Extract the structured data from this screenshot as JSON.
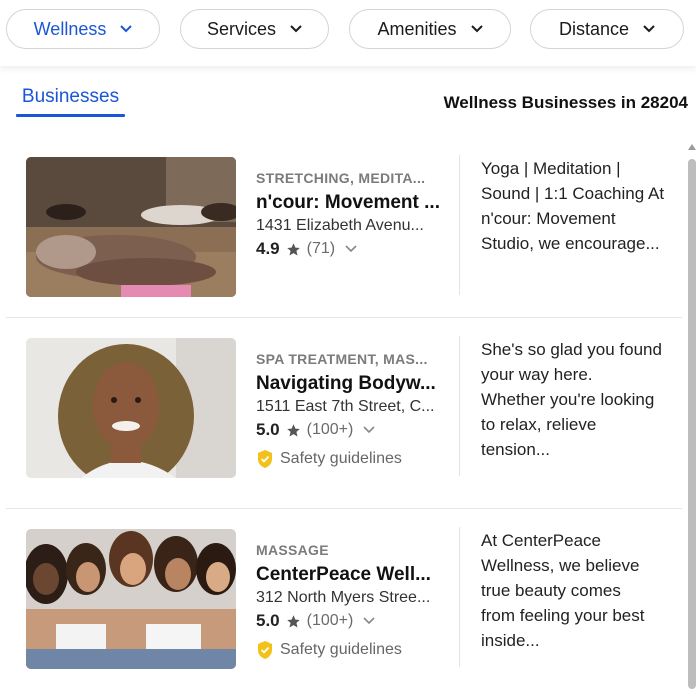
{
  "filters": [
    {
      "label": "Wellness",
      "active": true
    },
    {
      "label": "Services",
      "active": false
    },
    {
      "label": "Amenities",
      "active": false
    },
    {
      "label": "Distance",
      "active": false
    }
  ],
  "tabs": {
    "businesses": "Businesses"
  },
  "results_title": "Wellness Businesses in 28204",
  "businesses": [
    {
      "category": "STRETCHING, MEDITA...",
      "name": "n'cour: Movement ...",
      "address": "1431 Elizabeth Avenu...",
      "rating": "4.9",
      "reviews": "(71)",
      "safety": "",
      "description_lines": [
        "Yoga | Meditation |",
        "Sound | 1:1 Coaching At",
        "n'cour: Movement",
        "Studio, we encourage..."
      ]
    },
    {
      "category": "SPA TREATMENT, MAS...",
      "name": "Navigating Bodyw...",
      "address": "1511 East 7th Street, C...",
      "rating": "5.0",
      "reviews": "(100+)",
      "safety": "Safety guidelines",
      "description_lines": [
        "She's so glad you found",
        "your way here.",
        "Whether you're looking",
        "to relax, relieve",
        "tension..."
      ]
    },
    {
      "category": "MASSAGE",
      "name": "CenterPeace Well...",
      "address": "312 North Myers Stree...",
      "rating": "5.0",
      "reviews": "(100+)",
      "safety": "Safety guidelines",
      "description_lines": [
        "At CenterPeace",
        "Wellness, we believe",
        "true beauty comes",
        "from feeling your best",
        "inside..."
      ]
    }
  ],
  "colors": {
    "accent": "#1a56d6",
    "shield": "#f2c11a",
    "star": "#555555"
  },
  "icons": {
    "chevron": "chevron-down-icon",
    "star": "star-icon",
    "shield": "shield-icon"
  }
}
